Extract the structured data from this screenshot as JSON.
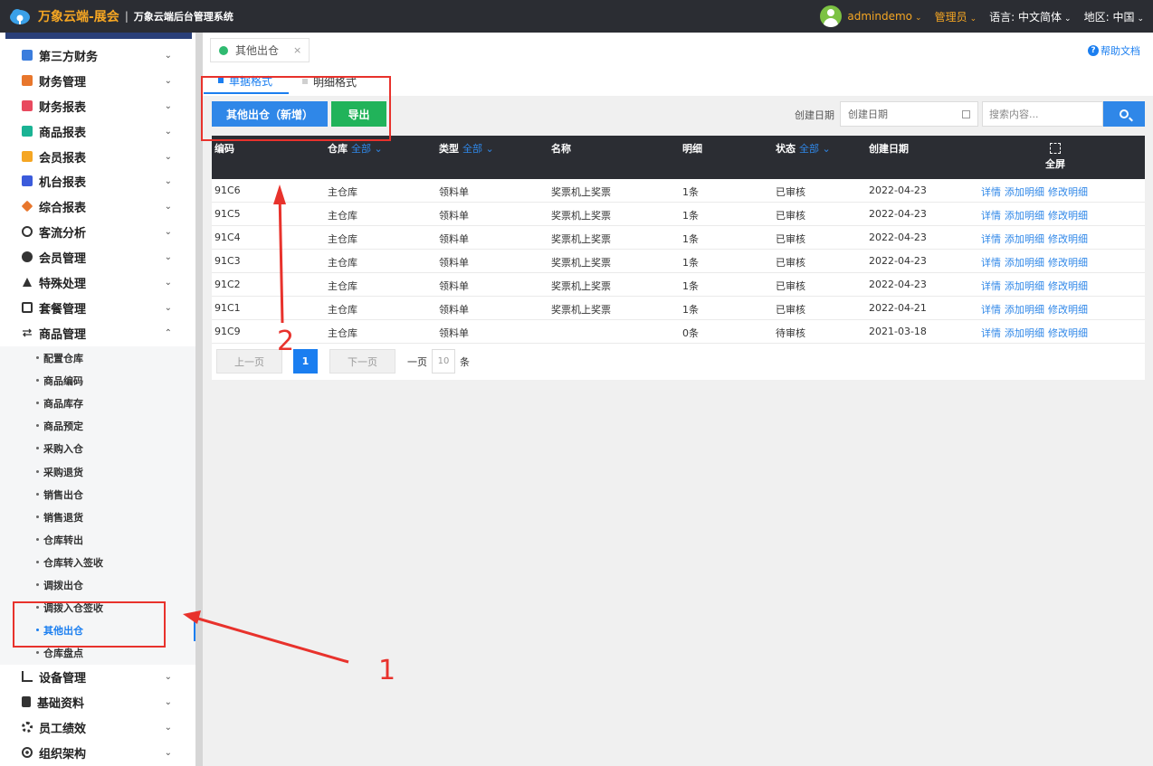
{
  "header": {
    "brand": "万象云端-展会",
    "separator": "|",
    "subtitle": "万象云端后台管理系统",
    "user": "admindemo",
    "role": "管理员",
    "language_label": "语言:",
    "language_value": "中文简体",
    "region_label": "地区:",
    "region_value": "中国",
    "chevron": "⌄"
  },
  "sidebar": {
    "menu": [
      {
        "label": "第三方财务",
        "icon": "finance-doc-icon",
        "color": "#3b7ddd"
      },
      {
        "label": "财务管理",
        "icon": "ledger-icon",
        "color": "#e8762c"
      },
      {
        "label": "财务报表",
        "icon": "report-icon",
        "color": "#e84a5f"
      },
      {
        "label": "商品报表",
        "icon": "goods-report-icon",
        "color": "#1ab394"
      },
      {
        "label": "会员报表",
        "icon": "member-report-icon",
        "color": "#f5a623"
      },
      {
        "label": "机台报表",
        "icon": "machine-report-icon",
        "color": "#3b5bdb"
      },
      {
        "label": "综合报表",
        "icon": "layers-icon",
        "color": "#e8762c"
      },
      {
        "label": "客流分析",
        "icon": "target-icon",
        "color": "#333333"
      },
      {
        "label": "会员管理",
        "icon": "user-icon",
        "color": "#333333"
      },
      {
        "label": "特殊处理",
        "icon": "warning-icon",
        "color": "#333333"
      },
      {
        "label": "套餐管理",
        "icon": "edit-icon",
        "color": "#333333"
      },
      {
        "label": "商品管理",
        "icon": "swap-icon",
        "color": "#333333"
      }
    ],
    "submenu": [
      "配置仓库",
      "商品编码",
      "商品库存",
      "商品预定",
      "采购入仓",
      "采购退货",
      "销售出仓",
      "销售退货",
      "仓库转出",
      "仓库转入签收",
      "调拨出仓",
      "调拨入仓签收",
      "其他出仓",
      "仓库盘点"
    ],
    "active_sub": "其他出仓",
    "menu_bottom": [
      {
        "label": "设备管理",
        "icon": "device-icon"
      },
      {
        "label": "基础资料",
        "icon": "file-icon"
      },
      {
        "label": "员工绩效",
        "icon": "gear-icon"
      },
      {
        "label": "组织架构",
        "icon": "org-icon"
      }
    ],
    "arrow_down": "⌄",
    "arrow_up": "⌃"
  },
  "tabs": {
    "page_tab": "其他出仓",
    "close": "×",
    "help": "帮助文档",
    "help_icon": "?",
    "view_tabs": [
      "单据格式",
      "明细格式"
    ]
  },
  "toolbar": {
    "add_button": "其他出仓（新增）",
    "export_button": "导出",
    "date_label": "创建日期",
    "date_placeholder": "创建日期",
    "search_placeholder": "搜索内容..."
  },
  "table": {
    "headers": {
      "code": "编码",
      "warehouse": "仓库",
      "type": "类型",
      "name": "名称",
      "detail": "明细",
      "status": "状态",
      "created": "创建日期",
      "fullscreen": "全屏",
      "filter_all": "全部 ⌄"
    },
    "rows": [
      {
        "code": "91C6",
        "warehouse": "主仓库",
        "type": "领料单",
        "name": "奖票机上奖票",
        "detail": "1条",
        "status": "已审核",
        "created": "2022-04-23"
      },
      {
        "code": "91C5",
        "warehouse": "主仓库",
        "type": "领料单",
        "name": "奖票机上奖票",
        "detail": "1条",
        "status": "已审核",
        "created": "2022-04-23"
      },
      {
        "code": "91C4",
        "warehouse": "主仓库",
        "type": "领料单",
        "name": "奖票机上奖票",
        "detail": "1条",
        "status": "已审核",
        "created": "2022-04-23"
      },
      {
        "code": "91C3",
        "warehouse": "主仓库",
        "type": "领料单",
        "name": "奖票机上奖票",
        "detail": "1条",
        "status": "已审核",
        "created": "2022-04-23"
      },
      {
        "code": "91C2",
        "warehouse": "主仓库",
        "type": "领料单",
        "name": "奖票机上奖票",
        "detail": "1条",
        "status": "已审核",
        "created": "2022-04-23"
      },
      {
        "code": "91C1",
        "warehouse": "主仓库",
        "type": "领料单",
        "name": "奖票机上奖票",
        "detail": "1条",
        "status": "已审核",
        "created": "2022-04-21"
      },
      {
        "code": "91C9",
        "warehouse": "主仓库",
        "type": "领料单",
        "name": "",
        "detail": "0条",
        "status": "待审核",
        "created": "2021-03-18"
      }
    ],
    "actions": [
      "详情",
      "添加明细",
      "修改明细"
    ]
  },
  "pager": {
    "prev": "上一页",
    "current": "1",
    "next": "下一页",
    "per_page_label": "一页",
    "per_page_value": "10",
    "per_page_unit": "条"
  },
  "annotations": {
    "label_1": "1",
    "label_2": "2",
    "color": "#e8322c"
  }
}
